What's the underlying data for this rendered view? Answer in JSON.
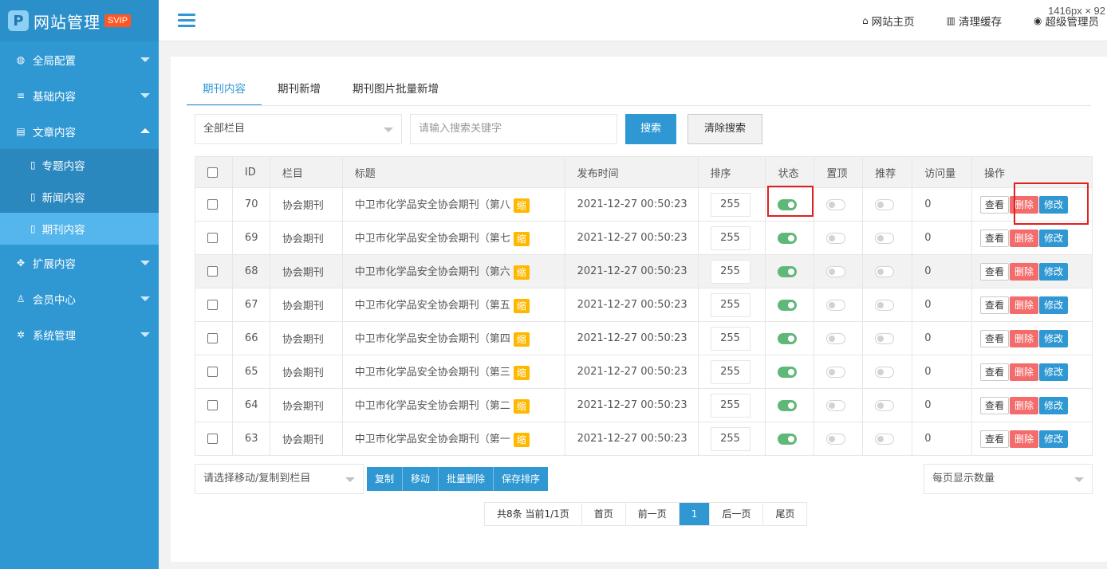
{
  "app": {
    "logo_char": "P",
    "title": "网站管理",
    "badge": "SVIP"
  },
  "sidebar": {
    "items": [
      {
        "label": "全局配置",
        "icon": "globe-icon"
      },
      {
        "label": "基础内容",
        "icon": "sliders-icon"
      },
      {
        "label": "文章内容",
        "icon": "document-icon",
        "expanded": true,
        "children": [
          {
            "label": "专题内容",
            "icon": "file-icon"
          },
          {
            "label": "新闻内容",
            "icon": "file-icon"
          },
          {
            "label": "期刊内容",
            "icon": "file-icon",
            "active": true
          }
        ]
      },
      {
        "label": "扩展内容",
        "icon": "expand-icon"
      },
      {
        "label": "会员中心",
        "icon": "user-icon"
      },
      {
        "label": "系统管理",
        "icon": "gear-icon"
      }
    ]
  },
  "header": {
    "links": [
      {
        "label": "网站主页",
        "icon": "home-icon"
      },
      {
        "label": "清理缓存",
        "icon": "trash-icon"
      },
      {
        "label": "超级管理员",
        "icon": "user-circle-icon"
      }
    ],
    "size_info": "1416px × 92"
  },
  "tabs": [
    "期刊内容",
    "期刊新增",
    "期刊图片批量新增"
  ],
  "filter": {
    "category_select": "全部栏目",
    "keyword_placeholder": "请输入搜索关键字",
    "search_label": "搜索",
    "clear_label": "清除搜索"
  },
  "table": {
    "columns": [
      "ID",
      "栏目",
      "标题",
      "发布时间",
      "排序",
      "状态",
      "置顶",
      "推荐",
      "访问量",
      "操作"
    ],
    "badge": "缩",
    "actions": {
      "view": "查看",
      "delete": "删除",
      "edit": "修改"
    },
    "rows": [
      {
        "id": "70",
        "category": "协会期刊",
        "title": "中卫市化学品安全协会期刊（第八",
        "date": "2021-12-27 00:50:23",
        "sort": "255",
        "status": true,
        "top": false,
        "recommend": false,
        "visits": "0"
      },
      {
        "id": "69",
        "category": "协会期刊",
        "title": "中卫市化学品安全协会期刊（第七",
        "date": "2021-12-27 00:50:23",
        "sort": "255",
        "status": true,
        "top": false,
        "recommend": false,
        "visits": "0"
      },
      {
        "id": "68",
        "category": "协会期刊",
        "title": "中卫市化学品安全协会期刊（第六",
        "date": "2021-12-27 00:50:23",
        "sort": "255",
        "status": true,
        "top": false,
        "recommend": false,
        "visits": "0"
      },
      {
        "id": "67",
        "category": "协会期刊",
        "title": "中卫市化学品安全协会期刊（第五",
        "date": "2021-12-27 00:50:23",
        "sort": "255",
        "status": true,
        "top": false,
        "recommend": false,
        "visits": "0"
      },
      {
        "id": "66",
        "category": "协会期刊",
        "title": "中卫市化学品安全协会期刊（第四",
        "date": "2021-12-27 00:50:23",
        "sort": "255",
        "status": true,
        "top": false,
        "recommend": false,
        "visits": "0"
      },
      {
        "id": "65",
        "category": "协会期刊",
        "title": "中卫市化学品安全协会期刊（第三",
        "date": "2021-12-27 00:50:23",
        "sort": "255",
        "status": true,
        "top": false,
        "recommend": false,
        "visits": "0"
      },
      {
        "id": "64",
        "category": "协会期刊",
        "title": "中卫市化学品安全协会期刊（第二",
        "date": "2021-12-27 00:50:23",
        "sort": "255",
        "status": true,
        "top": false,
        "recommend": false,
        "visits": "0"
      },
      {
        "id": "63",
        "category": "协会期刊",
        "title": "中卫市化学品安全协会期刊（第一",
        "date": "2021-12-27 00:50:23",
        "sort": "255",
        "status": true,
        "top": false,
        "recommend": false,
        "visits": "0"
      }
    ]
  },
  "bulk": {
    "move_select": "请选择移动/复制到栏目",
    "buttons": [
      "复制",
      "移动",
      "批量删除",
      "保存排序"
    ],
    "page_size_select": "每页显示数量"
  },
  "pager": {
    "summary": "共8条 当前1/1页",
    "first": "首页",
    "prev": "前一页",
    "current": "1",
    "next": "后一页",
    "last": "尾页"
  },
  "colors": {
    "accent": "#2f98d3",
    "sidebar": "#2f98d3",
    "danger": "#f36b6b",
    "toggle_on": "#5fb878",
    "badge": "#ffb800",
    "highlight": "#e02020"
  }
}
